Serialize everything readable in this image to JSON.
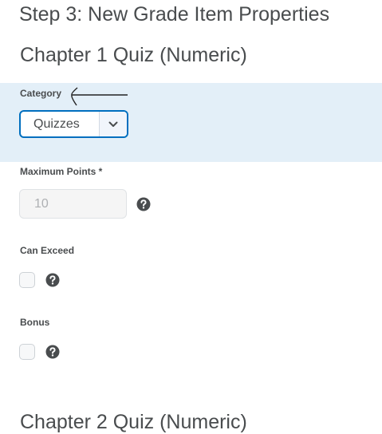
{
  "page": {
    "step_heading": "Step 3: New Grade Item Properties"
  },
  "items": [
    {
      "title": "Chapter 1 Quiz (Numeric)",
      "category": {
        "label": "Category",
        "selected": "Quizzes"
      },
      "max_points": {
        "label": "Maximum Points *",
        "value": "10"
      },
      "can_exceed": {
        "label": "Can Exceed",
        "checked": false
      },
      "bonus": {
        "label": "Bonus",
        "checked": false
      }
    },
    {
      "title": "Chapter 2 Quiz (Numeric)"
    }
  ],
  "icons": {
    "help": "question-circle-icon",
    "dropdown": "chevron-down-icon",
    "annotation": "arrow-left-icon"
  },
  "colors": {
    "highlight_panel": "#e3eff8",
    "focus_border": "#006fbf",
    "text": "#494c4e",
    "help_icon": "#494c4e"
  }
}
